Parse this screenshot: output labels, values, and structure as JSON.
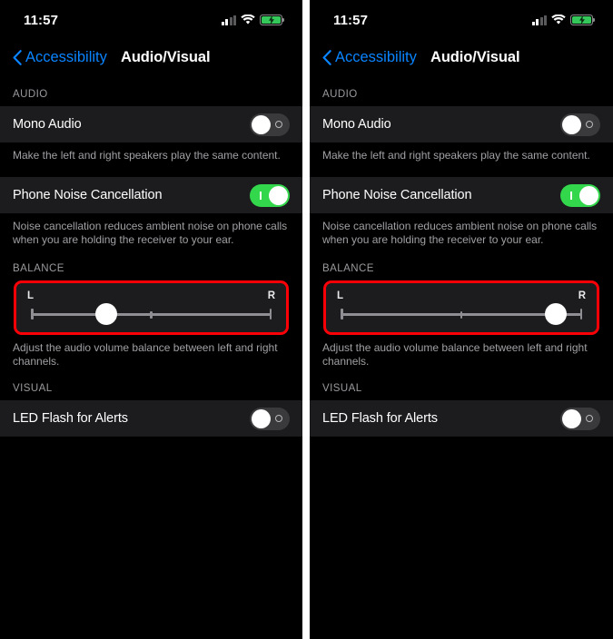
{
  "meta": {
    "accent_blue": "#0a84ff",
    "toggle_on_green": "#32d74b",
    "toggle_off_gray": "#3a3a3c",
    "highlight_red": "#fb0007",
    "row_bg": "#1c1c1e",
    "page_bg": "#000000",
    "battery_green": "#34c759"
  },
  "status_bar": {
    "time": "11:57",
    "cellular_icon": "cellular-signal-icon",
    "cellular_bars_filled": 2,
    "cellular_bars_total": 4,
    "wifi_icon": "wifi-icon",
    "battery_icon": "battery-charging-icon",
    "battery_charging": true
  },
  "nav": {
    "back_label": "Accessibility",
    "back_icon": "chevron-left-icon",
    "title": "Audio/Visual"
  },
  "sections": {
    "audio": {
      "header": "AUDIO",
      "mono_audio": {
        "label": "Mono Audio",
        "toggle_state": "off",
        "footer": "Make the left and right speakers play the same content."
      },
      "noise_cancellation": {
        "label": "Phone Noise Cancellation",
        "toggle_state": "on",
        "footer": "Noise cancellation reduces ambient noise on phone calls when you are holding the receiver to your ear."
      }
    },
    "balance": {
      "header": "BALANCE",
      "left_label": "L",
      "right_label": "R",
      "footer": "Adjust the audio volume balance between left and right channels.",
      "highlighted": true
    },
    "visual": {
      "header": "VISUAL",
      "led_flash": {
        "label": "LED Flash for Alerts",
        "toggle_state": "off"
      }
    }
  },
  "panels": [
    {
      "id": "left-panel",
      "balance_value_percent": 32
    },
    {
      "id": "right-panel",
      "balance_value_percent": 88
    }
  ]
}
